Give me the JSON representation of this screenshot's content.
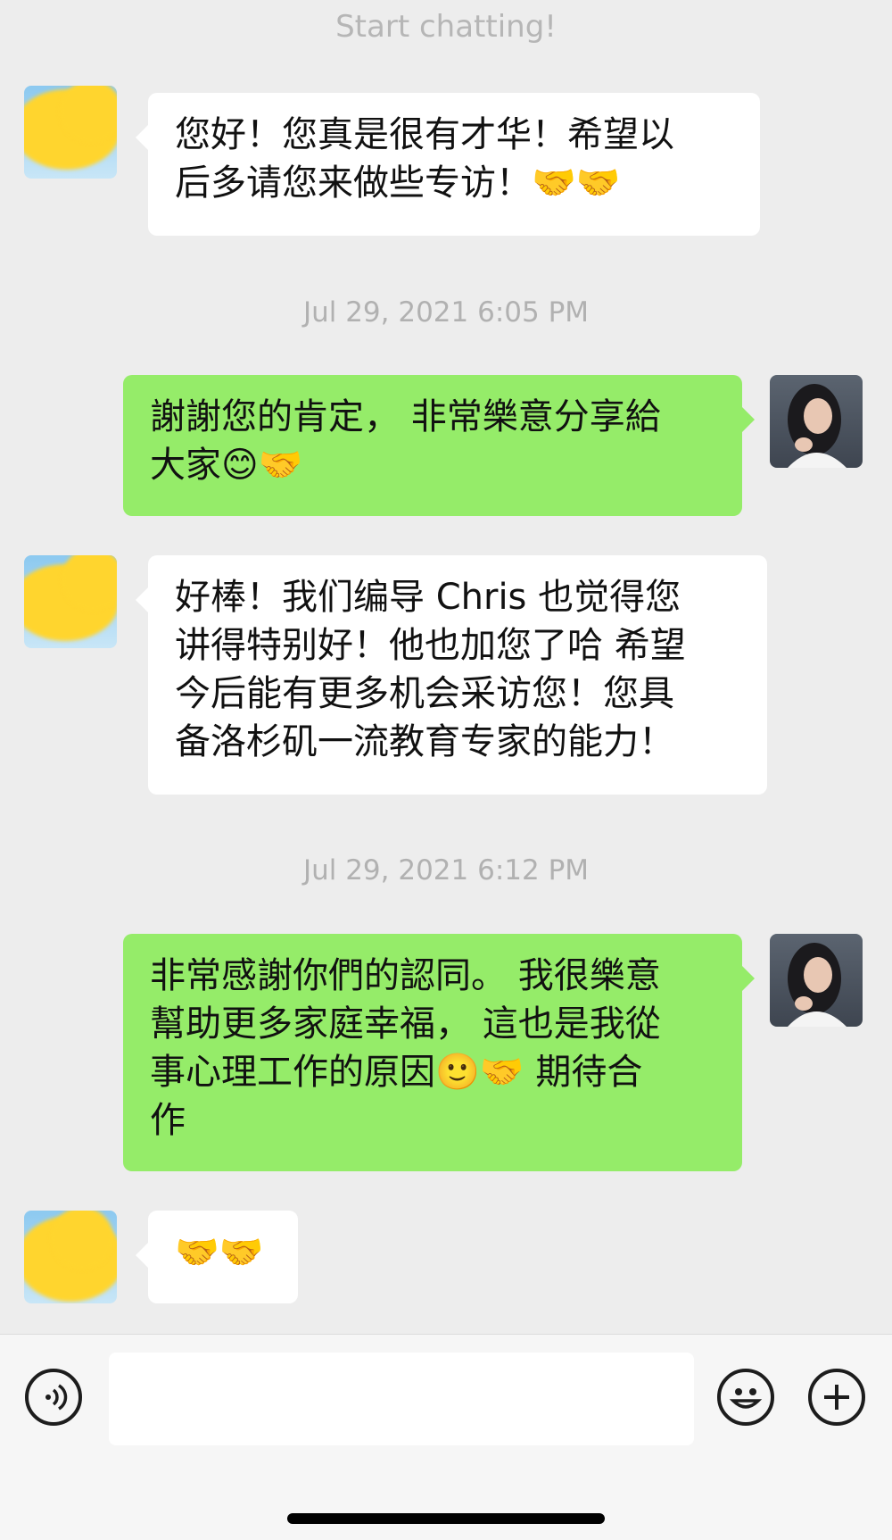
{
  "header": {
    "start_text": "Start chatting!"
  },
  "messages": [
    {
      "sender": "other",
      "text": "您好！您真是很有才华！希望以\n后多请您来做些专访！🤝🤝"
    },
    {
      "timestamp": "Jul 29, 2021 6:05 PM"
    },
    {
      "sender": "self",
      "text": "謝謝您的肯定， 非常樂意分享給\n大家😊🤝"
    },
    {
      "sender": "other",
      "text": "好棒！我们编导 Chris 也觉得您\n讲得特别好！他也加您了哈 希望\n今后能有更多机会采访您！您具\n备洛杉矶一流教育专家的能力！"
    },
    {
      "timestamp": "Jul 29, 2021 6:12 PM"
    },
    {
      "sender": "self",
      "text": "非常感謝你們的認同。 我很樂意\n幫助更多家庭幸福， 這也是我從\n事心理工作的原因🙂🤝 期待合\n作"
    },
    {
      "sender": "other",
      "text": "🤝🤝"
    }
  ],
  "input_bar": {
    "voice_icon": "voice-icon",
    "emoji_icon": "emoji-icon",
    "plus_icon": "plus-icon",
    "input_value": ""
  },
  "colors": {
    "background": "#ededed",
    "self_bubble": "#95ec69",
    "other_bubble": "#ffffff",
    "timestamp_text": "#b1b1b1"
  }
}
